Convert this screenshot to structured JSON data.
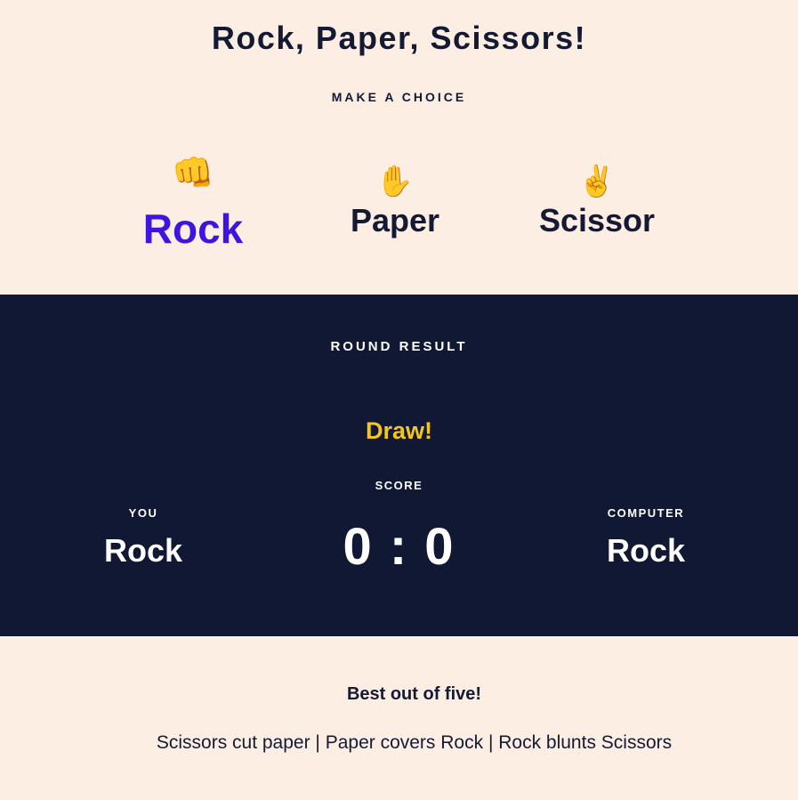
{
  "header": {
    "title": "Rock, Paper, Scissors!",
    "subtitle": "MAKE A CHOICE"
  },
  "choices": [
    {
      "emoji": "👊",
      "label": "Rock",
      "selected": true
    },
    {
      "emoji": "✋",
      "label": "Paper",
      "selected": false
    },
    {
      "emoji": "✌️",
      "label": "Scissor",
      "selected": false
    }
  ],
  "result": {
    "heading": "ROUND RESULT",
    "outcome": "Draw!",
    "score_label": "SCORE",
    "score": "0 : 0",
    "you": {
      "label": "YOU",
      "pick": "Rock"
    },
    "computer": {
      "label": "COMPUTER",
      "pick": "Rock"
    }
  },
  "footer": {
    "best_of": "Best out of five!",
    "rules": "Scissors cut paper | Paper covers Rock | Rock blunts Scissors"
  },
  "colors": {
    "background": "#fdeee3",
    "dark_panel": "#111833",
    "selected": "#3d14e0",
    "outcome": "#f5c518"
  }
}
